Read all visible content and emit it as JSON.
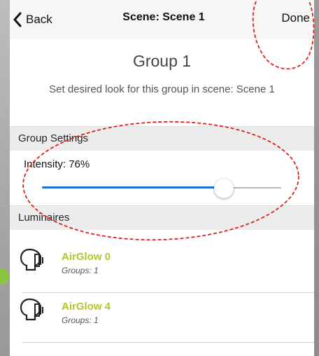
{
  "navbar": {
    "back_label": "Back",
    "title": "Scene: Scene 1",
    "done_label": "Done"
  },
  "header": {
    "title": "Group 1",
    "subtitle": "Set desired look for this group in scene: Scene 1"
  },
  "group_settings": {
    "section_label": "Group Settings",
    "intensity_label": "Intensity: 76%",
    "intensity_value": 0.76
  },
  "luminaires": {
    "section_label": "Luminaires",
    "items": [
      {
        "name": "AirGlow 0",
        "groups": "Groups: 1",
        "icon": "lightbulb-icon"
      },
      {
        "name": "AirGlow 4",
        "groups": "Groups: 1",
        "icon": "lightbulb-icon"
      }
    ]
  },
  "colors": {
    "accent": "#1f6fe0",
    "luminaire_name": "#b7c52a",
    "annotation": "#e0201c"
  }
}
